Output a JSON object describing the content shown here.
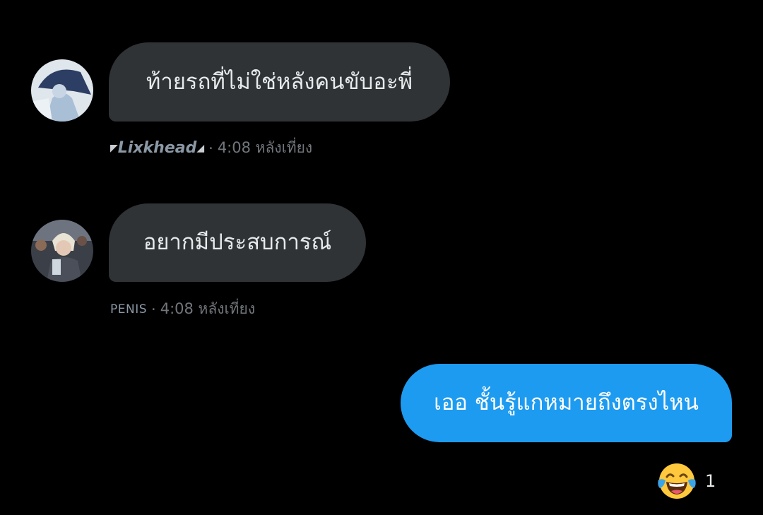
{
  "conversation": {
    "messages": [
      {
        "direction": "incoming",
        "text": "ท้ายรถที่ไม่ใช่หลังคนขับอะพี่",
        "sender": "Lixkhead",
        "sender_prefix_glyph": "◤",
        "sender_suffix_glyph": "◢",
        "separator": "·",
        "time": "4:08 หลังเที่ยง",
        "avatar": "avatar-photo-1"
      },
      {
        "direction": "incoming",
        "text": "อยากมีประสบการณ์",
        "sender": "PENIS",
        "separator": "·",
        "time": "4:08 หลังเที่ยง",
        "avatar": "avatar-photo-2"
      },
      {
        "direction": "outgoing",
        "text": "เออ ชั้นรู้แกหมายถึงตรงไหน",
        "reaction": {
          "emoji": "face-with-tears-of-joy",
          "count": "1"
        }
      }
    ]
  },
  "colors": {
    "background": "#000000",
    "incoming_bubble": "#2f3336",
    "outgoing_bubble": "#1d9bf0",
    "meta_text": "#71767b"
  }
}
